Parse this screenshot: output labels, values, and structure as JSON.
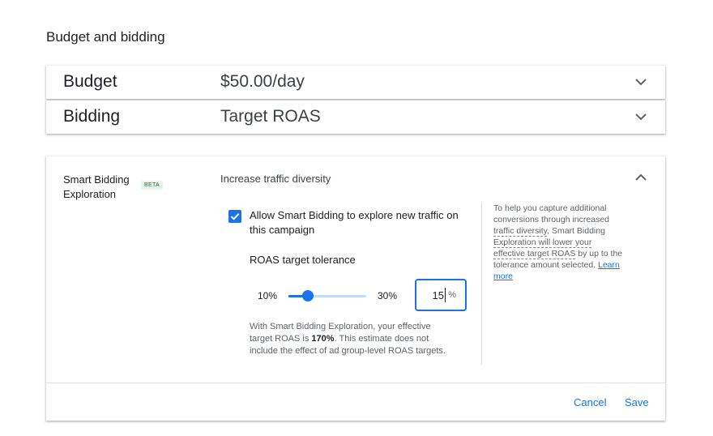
{
  "section_title": "Budget and bidding",
  "budget": {
    "label": "Budget",
    "value": "$50.00/day"
  },
  "bidding": {
    "label": "Bidding",
    "value": "Target ROAS"
  },
  "exploration": {
    "title": "Smart Bidding Exploration",
    "beta_badge": "BETA",
    "heading": "Increase traffic diversity",
    "checkbox_checked": true,
    "checkbox_label": "Allow Smart Bidding to explore new traffic on this campaign",
    "tolerance_title": "ROAS target tolerance",
    "slider": {
      "min_label": "10%",
      "max_label": "30%",
      "min": 10,
      "max": 30,
      "value": 15
    },
    "tolerance_value": "15",
    "tolerance_unit": "%",
    "estimate": {
      "part1": "With Smart Bidding Exploration, your effective target ROAS is ",
      "highlight": "170%",
      "part2": ". This estimate does not include the effect of ad group-level ROAS targets."
    },
    "help": {
      "part1": "To help you capture additional conversions through increased ",
      "term1": "traffic diversity",
      "part2": ", Smart Bidding ",
      "term2": "Exploration will lower your effective target ROAS",
      "part3": " by up to the tolerance amount selected.",
      "link": "Learn more"
    },
    "cancel_label": "Cancel",
    "save_label": "Save"
  },
  "colors": {
    "accent": "#1a73e8",
    "beta_bg": "#e6f4ea",
    "beta_text": "#188038"
  }
}
